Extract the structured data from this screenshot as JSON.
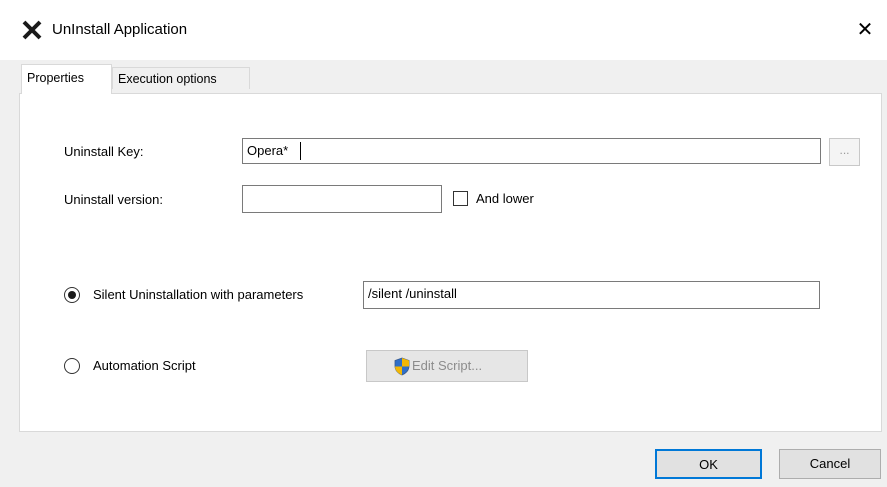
{
  "window": {
    "title": "UnInstall Application",
    "close_glyph": "✕",
    "icon": "x-app-icon"
  },
  "tabs": [
    {
      "label": "Properties",
      "active": true
    },
    {
      "label": "Execution options",
      "active": false
    }
  ],
  "form": {
    "uninstall_key_label": "Uninstall Key:",
    "uninstall_key_value": "Opera*",
    "browse_label": "...",
    "uninstall_version_label": "Uninstall version:",
    "uninstall_version_value": "",
    "and_lower_label": "And lower",
    "and_lower_checked": false,
    "silent_label": "Silent Uninstallation with parameters",
    "silent_selected": true,
    "silent_params_value": "/silent /uninstall",
    "automation_label": "Automation Script",
    "automation_selected": false,
    "edit_script_label": "Edit Script...",
    "edit_script_icon": "uac-shield-icon"
  },
  "buttons": {
    "ok": "OK",
    "cancel": "Cancel"
  },
  "colors": {
    "accent": "#0078d7",
    "shield_blue": "#2f6fc9",
    "shield_gold": "#f2b705"
  }
}
